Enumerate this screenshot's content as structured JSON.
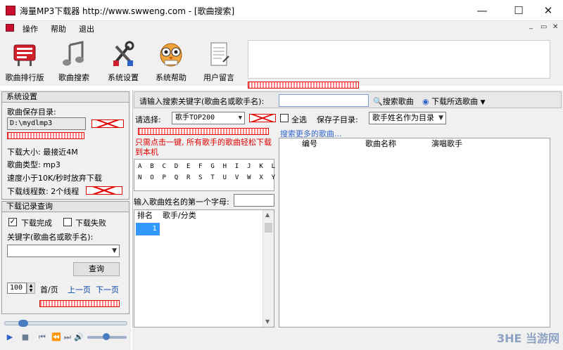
{
  "window": {
    "title": "海量MP3下载器  http://www.swweng.com - [歌曲搜索]",
    "minimize": "—",
    "maximize": "☐",
    "close": "✕"
  },
  "menu": {
    "items": [
      "操作",
      "帮助",
      "退出"
    ],
    "mdi_min": "_",
    "mdi_restore": "▭",
    "mdi_close": "✕"
  },
  "toolbar": {
    "buttons": [
      {
        "label": "歌曲排行版",
        "icon": "chart-board-icon"
      },
      {
        "label": "歌曲搜索",
        "icon": "music-notes-icon"
      },
      {
        "label": "系统设置",
        "icon": "tools-icon"
      },
      {
        "label": "系统帮助",
        "icon": "owl-help-icon"
      },
      {
        "label": "用户留言",
        "icon": "notepad-icon"
      }
    ]
  },
  "settings": {
    "header": "系统设置",
    "save_dir_label": "歌曲保存目录:",
    "save_dir_value": "D:\\mydlmp3",
    "download_size": "下载大小: 最接近4M",
    "song_type": "歌曲类型: mp3",
    "speed_rule": "速度小于10K/秒时放弃下载",
    "threads": "下载线程数: 2个线程"
  },
  "history": {
    "header": "下载记录查询",
    "done_label": "下载完成",
    "done_checked": true,
    "failed_label": "下载失败",
    "failed_checked": false,
    "keyword_label": "关键字(歌曲名或歌手名):",
    "query_button": "查询",
    "page_size": "100",
    "per_page_label": "首/页",
    "prev_page": "上一页",
    "next_page": "下一页"
  },
  "search": {
    "prompt": "请输入搜索关键字(歌曲名或歌手名):",
    "search_button": "搜索歌曲",
    "download_button": "下载所选歌曲",
    "select_label": "请选择:",
    "select_value": "歌手TOP200",
    "all_label": "全选",
    "subdir_label": "保存子目录:",
    "subdir_value": "歌手姓名作为目录",
    "more_songs": "搜索更多的歌曲...",
    "tip": "只需点击一键, 所有歌手的歌曲轻松下载到本机",
    "letters_row1": "A B C D E F G H I J K L M",
    "letters_row2": "N O P Q R S T U V W X Y Z",
    "first_letter_label": "输入歌曲姓名的第一个字母:"
  },
  "singer_table": {
    "columns": [
      "排名",
      "歌手/分类"
    ],
    "rows": [
      {
        "rank": "1",
        "name": ""
      }
    ]
  },
  "results_table": {
    "columns": [
      "编号",
      "歌曲名称",
      "演唱歌手"
    ]
  },
  "watermark": "3HE 当游网",
  "colors": {
    "accent": "#3399ff",
    "redacted": "#e00000"
  }
}
